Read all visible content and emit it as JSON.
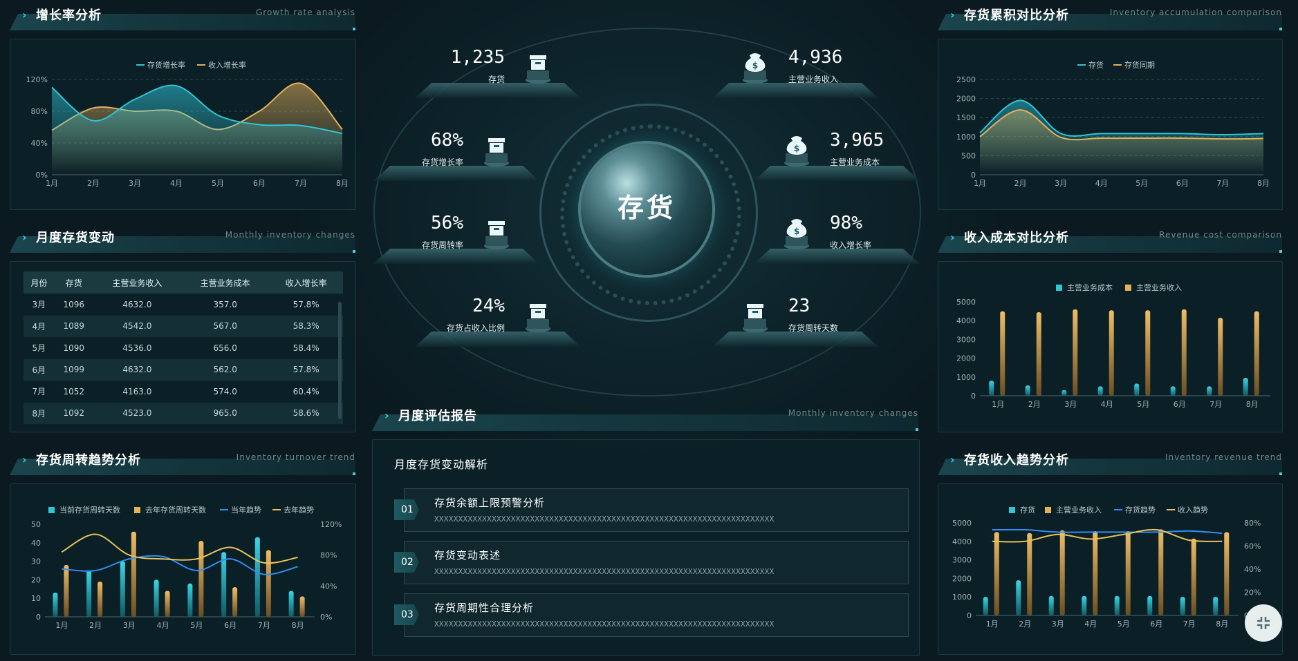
{
  "panels": {
    "growth": {
      "title": "增长率分析",
      "sub": "Growth rate analysis"
    },
    "monthly": {
      "title": "月度存货变动",
      "sub": "Monthly inventory changes"
    },
    "turnover": {
      "title": "存货周转趋势分析",
      "sub": "Inventory turnover trend"
    },
    "accum": {
      "title": "存货累积对比分析",
      "sub": "Inventory accumulation comparison"
    },
    "revcost": {
      "title": "收入成本对比分析",
      "sub": "Revenue cost comparison"
    },
    "invrev": {
      "title": "存货收入趋势分析",
      "sub": "Inventory revenue trend"
    },
    "report": {
      "title": "月度评估报告",
      "sub": "Monthly inventory changes"
    }
  },
  "table": {
    "headers": [
      "月份",
      "存货",
      "主营业务收入",
      "主营业务成本",
      "收入增长率"
    ],
    "rows": [
      [
        "3月",
        "1096",
        "4632.0",
        "357.0",
        "57.8%"
      ],
      [
        "4月",
        "1089",
        "4542.0",
        "567.0",
        "58.3%"
      ],
      [
        "5月",
        "1090",
        "4536.0",
        "656.0",
        "58.4%"
      ],
      [
        "6月",
        "1099",
        "4632.0",
        "562.0",
        "57.8%"
      ],
      [
        "7月",
        "1052",
        "4163.0",
        "574.0",
        "60.4%"
      ],
      [
        "8月",
        "1092",
        "4523.0",
        "965.0",
        "58.6%"
      ]
    ]
  },
  "kpis": [
    {
      "value": "1,235",
      "label": "存货",
      "icon": "archive-box-icon"
    },
    {
      "value": "68%",
      "label": "存货增长率",
      "icon": "archive-box-icon"
    },
    {
      "value": "56%",
      "label": "存货周转率",
      "icon": "archive-box-icon"
    },
    {
      "value": "24%",
      "label": "存货占收入比例",
      "icon": "archive-box-icon"
    },
    {
      "value": "4,936",
      "label": "主营业务收入",
      "icon": "money-bag-icon"
    },
    {
      "value": "3,965",
      "label": "主营业务成本",
      "icon": "money-bag-icon"
    },
    {
      "value": "98%",
      "label": "收入增长率",
      "icon": "money-bag-icon"
    },
    {
      "value": "23",
      "label": "存货周转天数",
      "icon": "archive-box-icon"
    }
  ],
  "center": {
    "label": "存货"
  },
  "report": {
    "heading": "月度存货变动解析",
    "items": [
      {
        "no": "01",
        "title": "存货余额上限预警分析",
        "desc": "XXXXXXXXXXXXXXXXXXXXXXXXXXXXXXXXXXXXXXXXXXXXXXXXXXXXXXXXXXXXXXXXXXXXXXX"
      },
      {
        "no": "02",
        "title": "存货变动表述",
        "desc": "XXXXXXXXXXXXXXXXXXXXXXXXXXXXXXXXXXXXXXXXXXXXXXXXXXXXXXXXXXXXXXXXXXXXXXX"
      },
      {
        "no": "03",
        "title": "存货周期性合理分析",
        "desc": "XXXXXXXXXXXXXXXXXXXXXXXXXXXXXXXXXXXXXXXXXXXXXXXXXXXXXXXXXXXXXXXXXXXXXXX"
      }
    ]
  },
  "colors": {
    "cyan": "#2fc6d6",
    "gold": "#e3b15a",
    "blue": "#2f8ef0",
    "yellow": "#e8c25c"
  },
  "chart_data": [
    {
      "id": "growth",
      "type": "line",
      "categories": [
        "1月",
        "2月",
        "3月",
        "4月",
        "5月",
        "6月",
        "7月",
        "8月"
      ],
      "series": [
        {
          "name": "存货增长率",
          "values": [
            110,
            68,
            95,
            112,
            75,
            63,
            62,
            52
          ]
        },
        {
          "name": "收入增长率",
          "values": [
            56,
            84,
            80,
            80,
            57,
            80,
            115,
            57
          ]
        }
      ],
      "ylim": [
        0,
        120
      ],
      "yticks": [
        "0%",
        "40%",
        "80%",
        "120%"
      ],
      "legend": "top-center",
      "grid": true
    },
    {
      "id": "turnover",
      "type": "bar",
      "categories": [
        "1月",
        "2月",
        "3月",
        "4月",
        "5月",
        "6月",
        "7月",
        "8月"
      ],
      "series": [
        {
          "name": "当前存货周转天数",
          "type": "bar",
          "values": [
            13,
            25,
            30,
            20,
            18,
            35,
            43,
            14
          ]
        },
        {
          "name": "去年存货周转天数",
          "type": "bar",
          "values": [
            28,
            19,
            46,
            14,
            41,
            16,
            36,
            11
          ]
        },
        {
          "name": "当年趋势",
          "type": "line",
          "axis": "right",
          "values": [
            62,
            60,
            75,
            78,
            60,
            75,
            55,
            65
          ]
        },
        {
          "name": "去年趋势",
          "type": "line",
          "axis": "right",
          "values": [
            84,
            107,
            80,
            75,
            75,
            90,
            70,
            77
          ]
        }
      ],
      "ylim": [
        0,
        50
      ],
      "yticks": [
        "0",
        "10",
        "20",
        "30",
        "40",
        "50"
      ],
      "y2lim": [
        0,
        120
      ],
      "y2ticks": [
        "0%",
        "40%",
        "80%",
        "120%"
      ],
      "legend": "top-center"
    },
    {
      "id": "accum",
      "type": "area",
      "categories": [
        "1月",
        "2月",
        "3月",
        "4月",
        "5月",
        "6月",
        "7月",
        "8月"
      ],
      "series": [
        {
          "name": "存货",
          "values": [
            1100,
            1950,
            1080,
            1080,
            1080,
            1080,
            1050,
            1080
          ]
        },
        {
          "name": "存货同期",
          "values": [
            1000,
            1700,
            980,
            960,
            960,
            960,
            940,
            950
          ]
        }
      ],
      "ylim": [
        0,
        2500
      ],
      "yticks": [
        "0",
        "500",
        "1000",
        "1500",
        "2000",
        "2500"
      ],
      "legend": "top-center",
      "grid": true
    },
    {
      "id": "revcost",
      "type": "bar",
      "categories": [
        "1月",
        "2月",
        "3月",
        "4月",
        "5月",
        "6月",
        "7月",
        "8月"
      ],
      "series": [
        {
          "name": "主营业务成本",
          "values": [
            800,
            550,
            300,
            500,
            650,
            500,
            500,
            950
          ]
        },
        {
          "name": "主营业务收入",
          "values": [
            4500,
            4450,
            4600,
            4550,
            4550,
            4600,
            4150,
            4500
          ]
        }
      ],
      "ylim": [
        0,
        5000
      ],
      "yticks": [
        "0",
        "1000",
        "2000",
        "3000",
        "4000",
        "5000"
      ],
      "legend": "top-center"
    },
    {
      "id": "invrev",
      "type": "bar",
      "categories": [
        "1月",
        "2月",
        "3月",
        "4月",
        "5月",
        "6月",
        "7月",
        "8月"
      ],
      "series": [
        {
          "name": "存货",
          "type": "bar",
          "values": [
            1000,
            1900,
            1050,
            1050,
            1050,
            1050,
            1000,
            1000
          ]
        },
        {
          "name": "主营业务收入",
          "type": "bar",
          "values": [
            4500,
            4450,
            4600,
            4550,
            4550,
            4650,
            4150,
            4500
          ]
        },
        {
          "name": "存货趋势",
          "type": "line",
          "axis": "right",
          "values": [
            74,
            74,
            72,
            72,
            72,
            72,
            73,
            71
          ]
        },
        {
          "name": "收入趋势",
          "type": "line",
          "axis": "right",
          "values": [
            64,
            64,
            70,
            66,
            70,
            74,
            65,
            64
          ]
        }
      ],
      "ylim": [
        0,
        5000
      ],
      "yticks": [
        "0",
        "1000",
        "2000",
        "3000",
        "4000",
        "5000"
      ],
      "y2lim": [
        0,
        80
      ],
      "y2ticks": [
        "0%",
        "20%",
        "40%",
        "60%",
        "80%"
      ],
      "legend": "top-center"
    }
  ]
}
